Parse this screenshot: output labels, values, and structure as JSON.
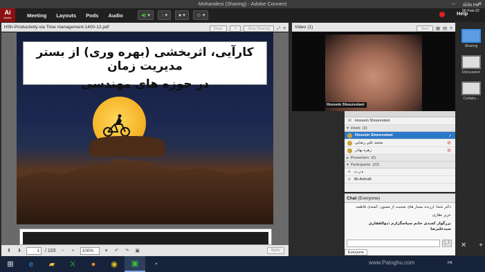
{
  "window": {
    "title": "Mohandesi (Sharing) - Adobe Connect"
  },
  "menubar": {
    "logo_text": "Ai",
    "logo_sub": "Adobe",
    "items": [
      "Meeting",
      "Layouts",
      "Pods",
      "Audio"
    ],
    "help_label": "Help"
  },
  "share_pod": {
    "title": "HSh-Productivity-via Time management-1400-12.pdf",
    "draw_label": "Draw",
    "stop_sharing_label": "Stop Sharing",
    "slide_title_line1": "کارآیی، اثربخشی (بهره وری) از بستر مدیریت زمان",
    "slide_title_line2": "در حوزه های مهندسی",
    "page_current": "1",
    "page_total": "/ 103",
    "zoom": "100%",
    "sync_label": "Sync"
  },
  "video_pod": {
    "title": "Video",
    "count": "(1)",
    "start_label": "Start",
    "speaker_name": "Hossein Shourestani"
  },
  "attendees": {
    "top_user": "Hossein Shourestani",
    "hosts_label": "Hosts",
    "hosts_count": "(3)",
    "hosts": [
      "Hossein Shourestani",
      "محمد علي رضايي",
      "زهره بهادر"
    ],
    "presenters_label": "Presenters",
    "presenters_count": "(0)",
    "participants_label": "Participants",
    "participants_count": "(22)",
    "participants": [
      "ه.ر.ب",
      "Ali-Ashrafi"
    ]
  },
  "chat": {
    "title": "Chat",
    "scope": "(Everyone)",
    "messages": [
      "دکتر شما: ارزنده بسیار های صحبت از ممنون :کمندی فاطمه",
      "عزیز نظاری",
      "بزرگوار کمندی خانم سپاسگزارم :ذوالفقاری سیدعلیرضا"
    ],
    "tab_label": "Everyone",
    "send_icon": "speech-bubble-icon"
  },
  "layouts": [
    "Sharing",
    "Discussion",
    "Collabo..."
  ],
  "taskbar": {
    "time": "12:35 PM",
    "date": "26-Feb-22",
    "lang": "FA",
    "watermark": "www.Patoghu.com"
  },
  "colors": {
    "accent": "#2c78c8",
    "brand": "#8b0f12",
    "record": "#e02020"
  }
}
